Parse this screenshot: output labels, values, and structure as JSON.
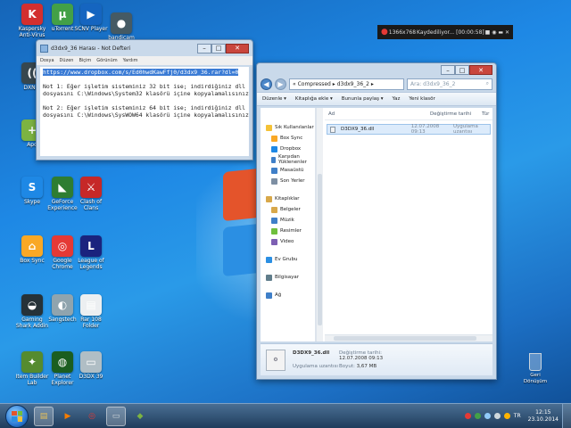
{
  "desktop": {
    "icons": [
      {
        "label": "Kaspersky Anti-Virus",
        "glyph": "K",
        "color": "#d32f2f",
        "icon": "kaspersky-icon"
      },
      {
        "label": "uTorrent",
        "glyph": "µ",
        "color": "#43a047",
        "icon": "utorrent-icon"
      },
      {
        "label": "SCNV Player",
        "glyph": "▶",
        "color": "#1565c0",
        "icon": "player-icon"
      },
      {
        "label": "bandicam",
        "glyph": "●",
        "color": "#455a64",
        "icon": "bandicam-icon"
      },
      {
        "label": "DXNet",
        "glyph": "((",
        "color": "#37474f",
        "icon": "network-icon"
      },
      {
        "label": "Apo",
        "glyph": "+",
        "color": "#7cb342",
        "icon": "app-icon"
      },
      {
        "label": "Skype",
        "glyph": "S",
        "color": "#1e88e5",
        "icon": "skype-icon"
      },
      {
        "label": "GeForce Experience",
        "glyph": "◣",
        "color": "#2e7d32",
        "icon": "geforce-icon"
      },
      {
        "label": "Clash of Clans",
        "glyph": "⚔",
        "color": "#c62828",
        "icon": "game-icon"
      },
      {
        "label": "Box Sync",
        "glyph": "⌂",
        "color": "#f9a825",
        "icon": "box-sync-icon"
      },
      {
        "label": "Google Chrome",
        "glyph": "◎",
        "color": "#e53935",
        "icon": "chrome-icon"
      },
      {
        "label": "League of Legends",
        "glyph": "L",
        "color": "#1a237e",
        "icon": "lol-icon"
      },
      {
        "label": "Gaming Shark Addin",
        "glyph": "◒",
        "color": "#263238",
        "icon": "shark-icon"
      },
      {
        "label": "Sangstech",
        "glyph": "◐",
        "color": "#90a4ae",
        "icon": "disc-icon"
      },
      {
        "label": "Rar 108 Folder",
        "glyph": "▤",
        "color": "#eceff1",
        "icon": "file-icon"
      },
      {
        "label": "Item Builder Lab",
        "glyph": "✦",
        "color": "#558b2f",
        "icon": "builder-icon"
      },
      {
        "label": "Planet Explorer",
        "glyph": "◍",
        "color": "#1b5e20",
        "icon": "globe-icon"
      },
      {
        "label": "D3DX 39",
        "glyph": "▭",
        "color": "#b0bec5",
        "icon": "dll-icon"
      }
    ],
    "recycle_bin": "Geri Dönüşüm"
  },
  "recbar": {
    "resolution": "1366x768",
    "status": "Kaydediliyor... [00:00:58]"
  },
  "notepad": {
    "title": "d3dx9_36 Harası - Not Defteri",
    "menu": [
      "Dosya",
      "Düzen",
      "Biçim",
      "Görünüm",
      "Yardım"
    ],
    "url": "https://www.dropbox.com/s/Ed0hwdKawFfj0/d3dx9_36.rar?dl=0",
    "lines": [
      "",
      "Not 1: Eğer işletim sisteminiz 32 bit ise; indirdiğiniz dll",
      "dosyasını C:\\Windows\\System32 klasörü içine kopyalamalısınız.",
      "",
      "Not 2: Eğer işletim sisteminiz 64 bit ise; indirdiğiniz dll",
      "dosyasını C:\\Windows\\SysWOW64 klasörü içine kopyalamalısınız."
    ]
  },
  "explorer": {
    "breadcrumb": "« Compressed ▸ d3dx9_36_2 ▸",
    "search_placeholder": "Ara: d3dx9_36_2",
    "toolbar": [
      "Düzenle ▾",
      "Kitaplığa ekle ▾",
      "Bununla paylaş ▾",
      "Yaz",
      "Yeni klasör"
    ],
    "nav": [
      {
        "label": "Sık Kullanılanlar",
        "color": "#f4c237",
        "child": false,
        "gap_before": false
      },
      {
        "label": "Box Sync",
        "color": "#f9a825",
        "child": true,
        "gap_before": false
      },
      {
        "label": "Dropbox",
        "color": "#1e88e5",
        "child": true,
        "gap_before": false
      },
      {
        "label": "Karşıdan Yüklenenler",
        "color": "#3f7fc8",
        "child": true,
        "gap_before": false
      },
      {
        "label": "Masaüstü",
        "color": "#3f7fc8",
        "child": true,
        "gap_before": false
      },
      {
        "label": "Son Yerler",
        "color": "#7d8fa3",
        "child": true,
        "gap_before": false
      },
      {
        "label": "Kitaplıklar",
        "color": "#d8a84a",
        "child": false,
        "gap_before": true
      },
      {
        "label": "Belgeler",
        "color": "#d8a84a",
        "child": true,
        "gap_before": false
      },
      {
        "label": "Müzik",
        "color": "#3f7fc8",
        "child": true,
        "gap_before": false
      },
      {
        "label": "Resimler",
        "color": "#6fbf3e",
        "child": true,
        "gap_before": false
      },
      {
        "label": "Video",
        "color": "#7d5fb3",
        "child": true,
        "gap_before": false
      },
      {
        "label": "Ev Grubu",
        "color": "#2b8fe3",
        "child": false,
        "gap_before": true
      },
      {
        "label": "Bilgisayar",
        "color": "#607d8b",
        "child": false,
        "gap_before": true
      },
      {
        "label": "Ağ",
        "color": "#3f7fc8",
        "child": false,
        "gap_before": true
      }
    ],
    "columns": [
      "Ad",
      "Değiştirme tarihi",
      "Tür"
    ],
    "file": {
      "name": "D3DX9_36.dll",
      "date": "12.07.2008 09:13",
      "type": "Uygulama uzantısı"
    },
    "details": {
      "name": "D3DX9_36.dll",
      "modified_key": "Değiştirme tarihi:",
      "modified_val": "12.07.2008 09:13",
      "type": "Uygulama uzantısı",
      "size_key": "Boyut:",
      "size_val": "3,67 MB"
    }
  },
  "taskbar": {
    "buttons": [
      {
        "glyph": "▤",
        "color": "#e8c15a",
        "icon": "explorer-taskbar-icon"
      },
      {
        "glyph": "▶",
        "color": "#f57c00",
        "icon": "media-player-icon"
      },
      {
        "glyph": "◎",
        "color": "#e53935",
        "icon": "chrome-taskbar-icon"
      },
      {
        "glyph": "▭",
        "color": "#cfd8dc",
        "icon": "notepad-taskbar-icon"
      },
      {
        "glyph": "◆",
        "color": "#7cb342",
        "icon": "bluestacks-icon"
      }
    ],
    "lang": "TR",
    "time": "12:15",
    "date": "23.10.2014"
  },
  "colors": {
    "accent": "#3a7bd5",
    "close": "#c9463d"
  }
}
